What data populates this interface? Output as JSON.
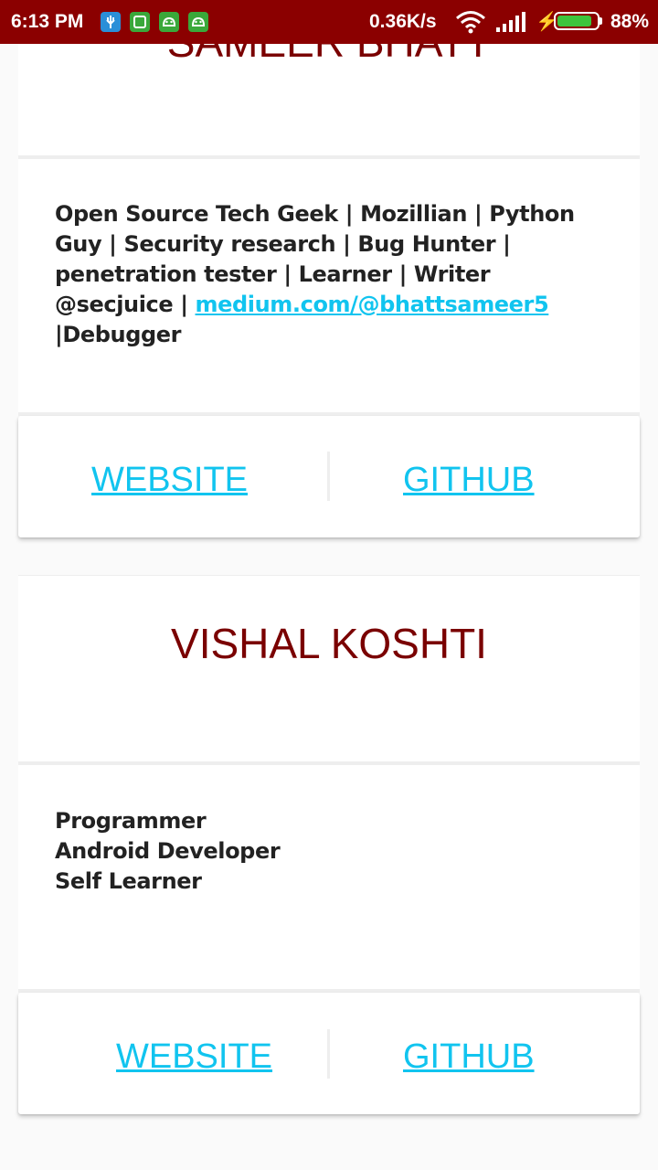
{
  "status_bar": {
    "time": "6:13 PM",
    "notification_icons": [
      "usb-debug-icon",
      "saavn-icon",
      "android-icon",
      "android-icon"
    ],
    "net_speed": "0.36K/s",
    "battery_percent": "88%",
    "battery_level": 0.88,
    "colors": {
      "background": "#8b0000",
      "battery": "#3cc43c"
    }
  },
  "profiles": [
    {
      "name": "SAMEER BHATT",
      "bio_segments": [
        "Open Source Tech Geek | Mozillian | Python Guy | Security research | Bug Hunter | penetration tester | Learner | Writer @secjuice | ",
        "medium.com/@bhattsameer5",
        " |Debugger"
      ],
      "website_label": "WEBSITE",
      "github_label": "GITHUB"
    },
    {
      "name": "VISHAL KOSHTI",
      "bio_lines": [
        "Programmer",
        "Android Developer",
        "Self Learner"
      ],
      "website_label": "WEBSITE",
      "github_label": "GITHUB"
    }
  ],
  "colors": {
    "name": "#7a0000",
    "link": "#11c4ef",
    "text": "#222222"
  }
}
